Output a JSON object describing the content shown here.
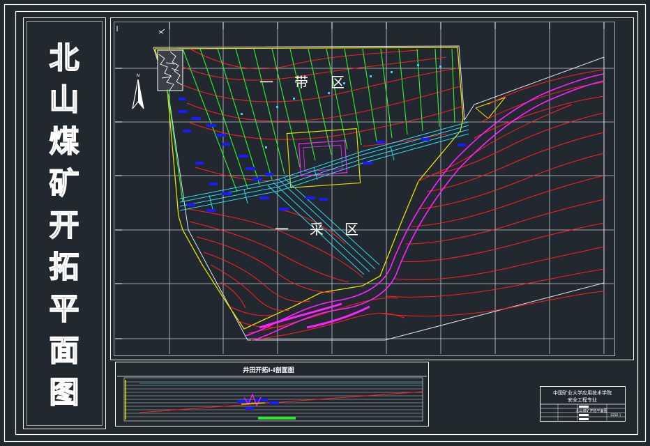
{
  "drawing": {
    "side_title_chars": [
      "北",
      "山",
      "煤",
      "矿",
      "开",
      "拓",
      "平",
      "面",
      "图"
    ],
    "zone_upper": [
      "一",
      "带",
      "区"
    ],
    "zone_lower": [
      "一",
      "采",
      "区"
    ],
    "section_title": "井田开拓Ⅰ-Ⅰ剖面图",
    "title_block": {
      "line1": "中国矿业大学应用技术学院",
      "line2": "安全工程专业",
      "drawing_name": "北山煤矿开拓平面图",
      "drawing_no": "DZ82-1"
    },
    "north_arrow_label": "N"
  },
  "colors": {
    "background": "#212830",
    "frame": "#ffffff",
    "grid": "#c8ccd2",
    "contour": "#ff2020",
    "boundary": "#e8e000",
    "panel_green": "#2ee82e",
    "roadway_cyan": "#30d8ee",
    "river_magenta": "#ff22ff",
    "equipment_blue": "#1a1aff"
  }
}
